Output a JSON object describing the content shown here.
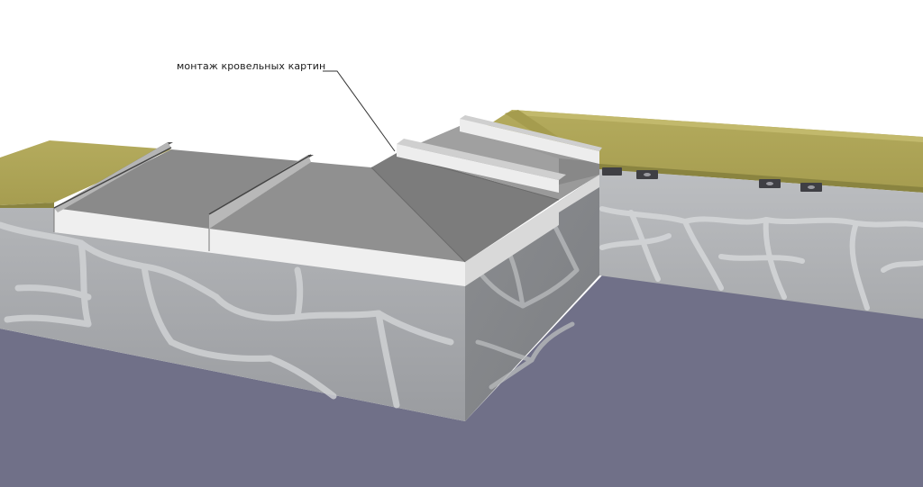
{
  "annotation": {
    "label": "монтаж кровельных картин"
  },
  "colors": {
    "ground": "#707088",
    "stone_front": "#a6a8ab",
    "stone_side": "#8e9093",
    "stone_joint": "#d3d5d7",
    "insulation_top": "#b0a75a",
    "insulation_edge": "#8a8440",
    "panel_front": "#eeeeee",
    "roof_panel": "#8a8a8a",
    "roof_panel_dark": "#7a7a7a",
    "roof_panel_light": "#9a9a9a"
  }
}
